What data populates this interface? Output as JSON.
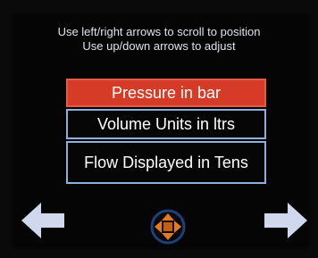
{
  "screen": {
    "instructions": [
      "Use left/right arrows to scroll to position",
      "Use up/down arrows to adjust"
    ],
    "options": [
      {
        "label": "Pressure in bar",
        "selected": true
      },
      {
        "label": "Volume Units in ltrs",
        "selected": false
      },
      {
        "label": "Flow Displayed in Tens",
        "selected": false
      }
    ]
  },
  "icons": {
    "left": "left-arrow-icon",
    "right": "right-arrow-icon",
    "center": "dpad-icon"
  },
  "colors": {
    "selected_bg": "#d63b27",
    "option_border": "#8fb0d8",
    "arrow": "#cfd8ec",
    "dpad_orange": "#e07b1f",
    "dpad_ring": "#1e3f7a"
  }
}
